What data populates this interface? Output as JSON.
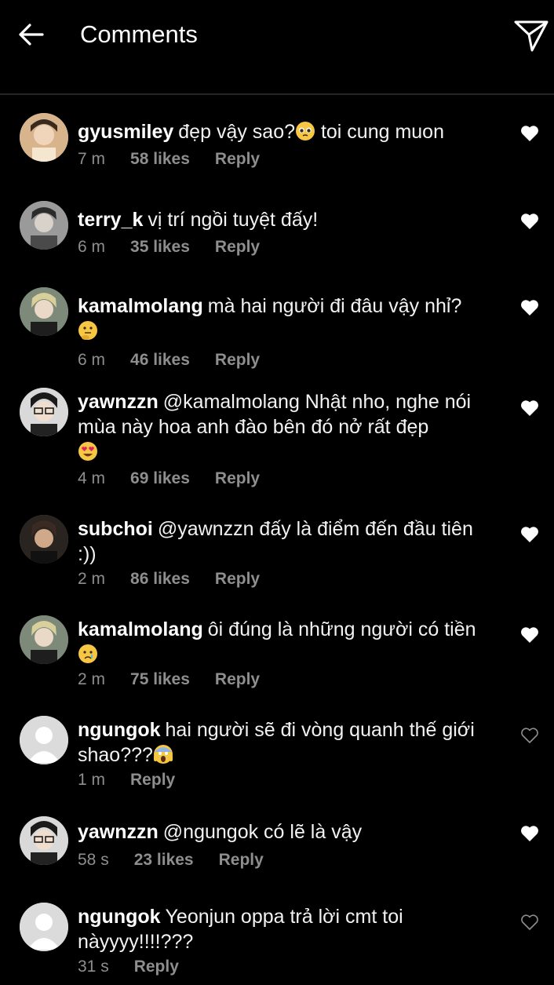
{
  "header": {
    "title": "Comments",
    "back_icon": "arrow-left-icon",
    "send_icon": "paper-plane-icon"
  },
  "colors": {
    "background": "#000000",
    "meta": "#8e8e8e",
    "divider": "#262626"
  },
  "comments": [
    {
      "username": "gyusmiley",
      "text": "đẹp vậy sao?",
      "emoji": "pleading-face",
      "text2": " toi cung muon",
      "time": "7 m",
      "likes": "58 likes",
      "reply": "Reply",
      "liked": true
    },
    {
      "username": "terry_k",
      "text": "vị trí ngồi tuyệt đấy!",
      "time": "6 m",
      "likes": "35 likes",
      "reply": "Reply",
      "liked": true
    },
    {
      "username": "kamalmolang",
      "text": "mà hai người đi đâu vậy nhỉ?",
      "emoji": "thinking-face",
      "time": "6 m",
      "likes": "46 likes",
      "reply": "Reply",
      "liked": true
    },
    {
      "username": "yawnzzn",
      "text": "@kamalmolang Nhật nho, nghe nói mùa này hoa anh đào bên đó nở rất đẹp",
      "emoji": "heart-eyes-face",
      "time": "4 m",
      "likes": "69 likes",
      "reply": "Reply",
      "liked": true
    },
    {
      "username": "subchoi",
      "text": "@yawnzzn đấy là điểm đến đầu tiên :))",
      "time": "2 m",
      "likes": "86 likes",
      "reply": "Reply",
      "liked": true
    },
    {
      "username": "kamalmolang",
      "text": "ôi đúng là những người có tiền",
      "emoji": "crying-face",
      "time": "2 m",
      "likes": "75 likes",
      "reply": "Reply",
      "liked": true
    },
    {
      "username": "ngungok",
      "text": "hai người sẽ đi vòng quanh thế giới shao???",
      "emoji": "screaming-face",
      "time": "1 m",
      "likes": "",
      "reply": "Reply",
      "liked": false
    },
    {
      "username": "yawnzzn",
      "text": "@ngungok có lẽ là vậy",
      "time": "58 s",
      "likes": "23 likes",
      "reply": "Reply",
      "liked": true
    },
    {
      "username": "ngungok",
      "text": "Yeonjun oppa trả lời cmt toi nàyyyy!!!!???",
      "time": "31 s",
      "likes": "",
      "reply": "Reply",
      "liked": false
    }
  ]
}
